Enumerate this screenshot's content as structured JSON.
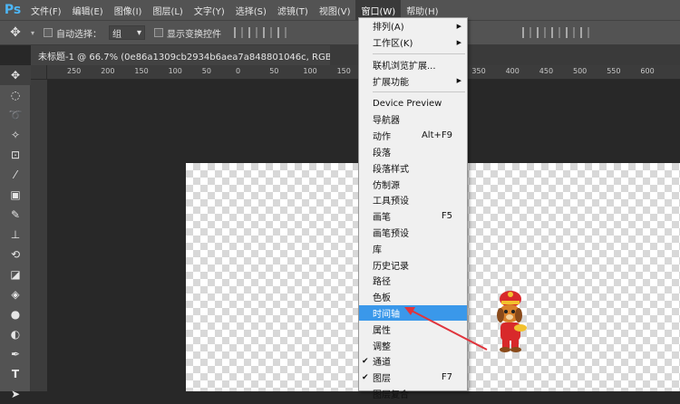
{
  "app": {
    "logo": "Ps"
  },
  "menubar": {
    "items": [
      "文件(F)",
      "编辑(E)",
      "图像(I)",
      "图层(L)",
      "文字(Y)",
      "选择(S)",
      "滤镜(T)",
      "视图(V)",
      "窗口(W)",
      "帮助(H)"
    ],
    "active_index": 8
  },
  "options": {
    "auto_select_label": "自动选择：",
    "auto_select_value": "组",
    "transform_label": "显示变换控件"
  },
  "document": {
    "tab_title": "未标题-1 @ 66.7% (0e86a1309cb2934b6aea7a848801046c, RGB/8) *",
    "close": "×"
  },
  "ruler": {
    "top_numbers": [
      "250",
      "200",
      "150",
      "100",
      "50",
      "0",
      "50",
      "100",
      "150",
      "200",
      "250",
      "300",
      "350",
      "400",
      "450",
      "500",
      "550",
      "600"
    ]
  },
  "window_menu": {
    "items": [
      {
        "label": "排列(A)",
        "submenu": true
      },
      {
        "label": "工作区(K)",
        "submenu": true
      },
      {
        "separator": true
      },
      {
        "label": "联机浏览扩展..."
      },
      {
        "label": "扩展功能",
        "submenu": true
      },
      {
        "separator": true
      },
      {
        "label": "Device Preview"
      },
      {
        "label": "导航器"
      },
      {
        "label": "动作",
        "shortcut": "Alt+F9"
      },
      {
        "label": "段落"
      },
      {
        "label": "段落样式"
      },
      {
        "label": "仿制源"
      },
      {
        "label": "工具预设"
      },
      {
        "label": "画笔",
        "shortcut": "F5"
      },
      {
        "label": "画笔预设"
      },
      {
        "label": "库"
      },
      {
        "label": "历史记录"
      },
      {
        "label": "路径"
      },
      {
        "label": "色板"
      },
      {
        "label": "时间轴",
        "highlight": true
      },
      {
        "label": "属性"
      },
      {
        "label": "调整"
      },
      {
        "label": "通道",
        "checked": true
      },
      {
        "label": "图层",
        "checked": true,
        "shortcut": "F7"
      },
      {
        "label": "图层复合"
      }
    ]
  },
  "colors": {
    "accent": "#3a98ea",
    "arrow": "#e0343c",
    "ps_blue": "#4db6f5"
  }
}
